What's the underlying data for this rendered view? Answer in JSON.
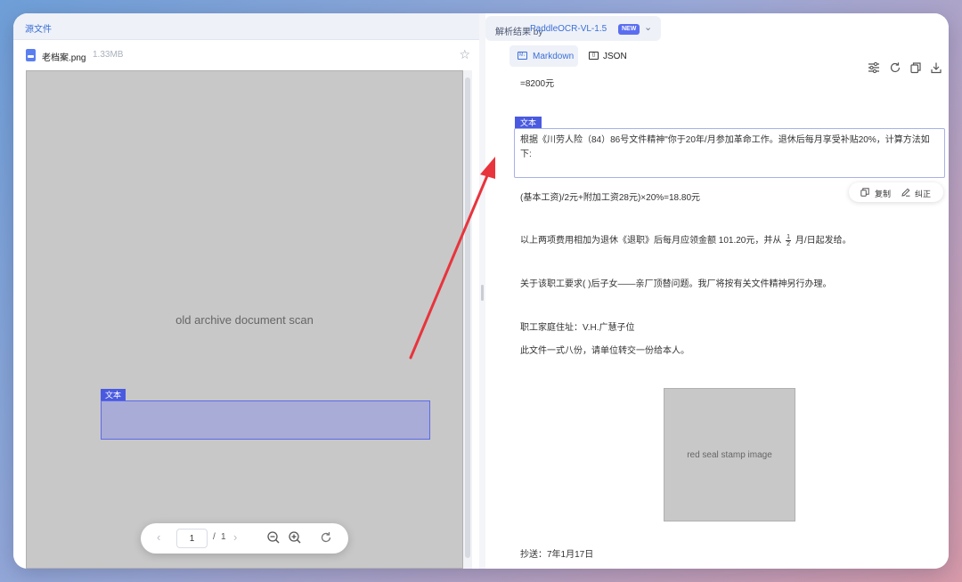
{
  "left_pane": {
    "tab_label": "源文件",
    "file_name": "老档案.png",
    "file_size": "1.33MB",
    "document_image_label": "old archive document scan",
    "ocr_block_tag": "文本",
    "pager": {
      "current_page": "1",
      "separator": "/",
      "total_pages": "1"
    }
  },
  "right_pane": {
    "result_label": "解析结果 by",
    "model_name": "PaddleOCR-VL-1.5",
    "new_badge": "NEW",
    "tabs": {
      "markdown": "Markdown",
      "json": "JSON"
    },
    "content": {
      "line_amount": "=8200元",
      "block_tag": "文本",
      "selected_block": "根据《川劳人险（84）86号文件精神\"你于20年/月参加革命工作。退休后每月享受补贴20%，计算方法如下:",
      "formula_line": "(基本工资)/2元+附加工资28元)×20%=18.80元",
      "total_line_prefix": "以上两项费用相加为退休《退职》后每月应领金额 101.20元，并从",
      "total_fraction_num": "1",
      "total_fraction_den": "2",
      "total_line_suffix": "月/日起发给。",
      "successor_line": "关于该职工要求( )后子女——亲厂顶替问题。我厂将按有关文件精神另行办理。",
      "address_line": "职工家庭住址：V.H.广慧子位",
      "copies_line": "此文件一式八份，请单位转交一份给本人。",
      "seal_image_label": "red seal stamp image",
      "cc_line": "抄送：7年1月17日"
    },
    "actions": {
      "copy": "复制",
      "correct": "纠正"
    }
  },
  "colors": {
    "accent_blue": "#3a6fd8",
    "tag_indigo": "#4a5ae0",
    "arrow_red": "#e8343c"
  }
}
